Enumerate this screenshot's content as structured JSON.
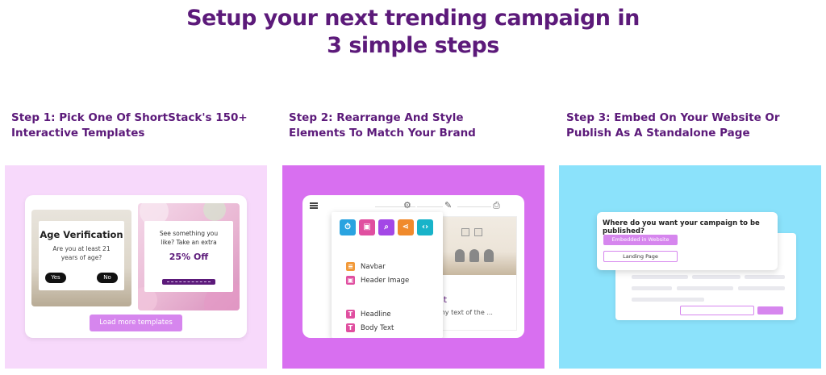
{
  "header": {
    "title_line1": "Setup your next trending campaign in",
    "title_line2": "3 simple steps"
  },
  "steps": [
    {
      "heading_line1": "Step 1: Pick One Of ShortStack's 150+",
      "heading_line2": "Interactive Templates",
      "templates": {
        "age_title": "Age Verification",
        "age_question_line1": "Are you at least 21",
        "age_question_line2": "years of age?",
        "yes_label": "Yes",
        "no_label": "No",
        "offer_line1": "See something you",
        "offer_line2": "like? Take an extra",
        "offer_percent": "25% Off",
        "load_more_label": "Load more templates"
      }
    },
    {
      "heading_line1": "Step 2: Rearrange And Style",
      "heading_line2": "Elements To Match Your Brand",
      "editor": {
        "element_icons": [
          {
            "name": "timer-icon",
            "glyph": "⏱",
            "color": "#2aa3e0"
          },
          {
            "name": "image-icon",
            "glyph": "▣",
            "color": "#e04fa0"
          },
          {
            "name": "search-icon",
            "glyph": "⌕",
            "color": "#a347e6"
          },
          {
            "name": "share-icon",
            "glyph": "<",
            "color": "#f08a2c"
          },
          {
            "name": "code-icon",
            "glyph": "‹›",
            "color": "#18b3c9"
          }
        ],
        "items": [
          {
            "label": "Navbar",
            "glyph": "≡",
            "color": "#f29a3a"
          },
          {
            "label": "Header Image",
            "glyph": "▣",
            "color": "#e04fa0"
          },
          {
            "label": "Headline",
            "glyph": "T",
            "color": "#e04fa0"
          },
          {
            "label": "Body Text",
            "glyph": "T",
            "color": "#e04fa0"
          }
        ],
        "preview_heading_fragment": "st",
        "preview_text_fragment": "my text of the ..."
      }
    },
    {
      "heading_line1": "Step 3: Embed On Your Website Or",
      "heading_line2": "Publish As A Standalone Page",
      "publish": {
        "question": "Where do you want your campaign to be published?",
        "option_website": "Embedded in Website",
        "option_landing": "Landing Page"
      }
    }
  ],
  "colors": {
    "brand_purple": "#5c1a7a",
    "panel1_bg": "#f7d9fb",
    "panel2_bg": "#d86ff0",
    "panel3_bg": "#8be2fb",
    "accent_pink": "#d686ee"
  }
}
